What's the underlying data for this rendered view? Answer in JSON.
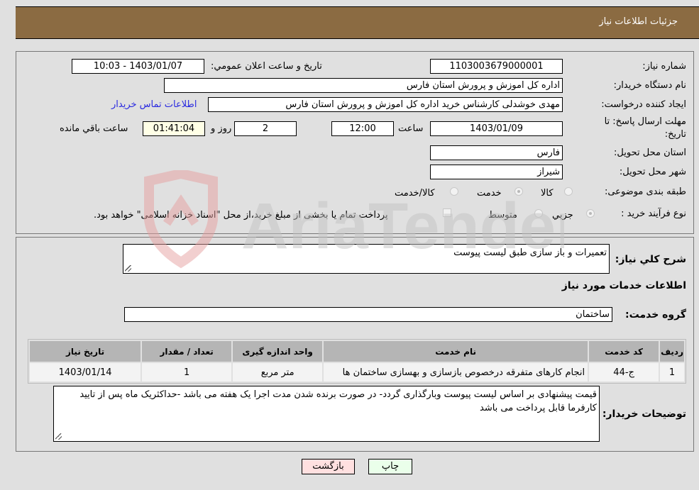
{
  "header": {
    "title": "جزئیات اطلاعات نیاز"
  },
  "details": {
    "need_number_label": "شماره نیاز:",
    "need_number": "1103003679000001",
    "announce_label": "تاریخ و ساعت اعلان عمومي:",
    "announce_value": "1403/01/07 - 10:03",
    "buyer_org_label": "نام دستگاه خریدار:",
    "buyer_org": "اداره کل اموزش و پرورش استان فارس",
    "creator_label": "ایجاد کننده درخواست:",
    "creator": "مهدی خوشدلی کارشناس خرید اداره کل اموزش و پرورش استان فارس",
    "contact_link": "اطلاعات تماس خریدار",
    "deadline_label_1": "مهلت ارسال پاسخ: تا",
    "deadline_label_2": "تاریخ:",
    "deadline_date": "1403/01/09",
    "time_label": "ساعت",
    "deadline_time": "12:00",
    "days_value": "2",
    "days_label": "روز و",
    "remaining_time": "01:41:04",
    "remaining_label": "ساعت باقي مانده",
    "province_label": "استان محل تحویل:",
    "province": "فارس",
    "city_label": "شهر محل تحویل:",
    "city": "شیراز",
    "category_label": "طبقه بندی موضوعی:",
    "category_options": [
      {
        "label": "کالا",
        "selected": false
      },
      {
        "label": "خدمت",
        "selected": true
      },
      {
        "label": "کالا/خدمت",
        "selected": false
      }
    ],
    "process_label": "نوع فرآیند خرید :",
    "process_options": [
      {
        "label": "جزيي",
        "selected": true
      },
      {
        "label": "متوسط",
        "selected": false
      }
    ],
    "treasury_note": "پرداخت تمام یا بخشی از مبلغ خرید،از محل \"اسناد خزانه اسلامی\" خواهد بود.",
    "treasury_checked": false
  },
  "services": {
    "summary_label": "شرح کلي نیاز:",
    "summary": "تعمیرات و باز سازی طبق لیست پیوست",
    "section_title": "اطلاعات خدمات مورد نیاز",
    "group_label": "گروه خدمت:",
    "group": "ساختمان",
    "table": {
      "headers": [
        "ردیف",
        "کد خدمت",
        "نام خدمت",
        "واحد اندازه گیری",
        "تعداد / مقدار",
        "تاریخ نیاز"
      ],
      "rows": [
        [
          "1",
          "ج-44",
          "انجام کارهای متفرقه درخصوص بازسازی و بهسازی ساختمان ها",
          "متر مربع",
          "1",
          "1403/01/14"
        ]
      ]
    },
    "buyer_notes_label": "توضیحات خریدار:",
    "buyer_notes": "قیمت پیشنهادی بر اساس لیست پیوست وبارگذاری گردد- در صورت برنده شدن مدت اجرا یک هفته می باشد -حداکثریک ماه پس از تایید کارفرما قابل پرداخت می باشد"
  },
  "buttons": {
    "print": "چاپ",
    "back": "بازگشت"
  },
  "watermark": {
    "text": "AriaTender.neT"
  },
  "colors": {
    "header_bg": "#8b6b42",
    "link": "#2a2ae0",
    "back_bg": "#ffe0e0",
    "print_bg": "#eaffea",
    "remaining_bg": "#ffffe6"
  }
}
